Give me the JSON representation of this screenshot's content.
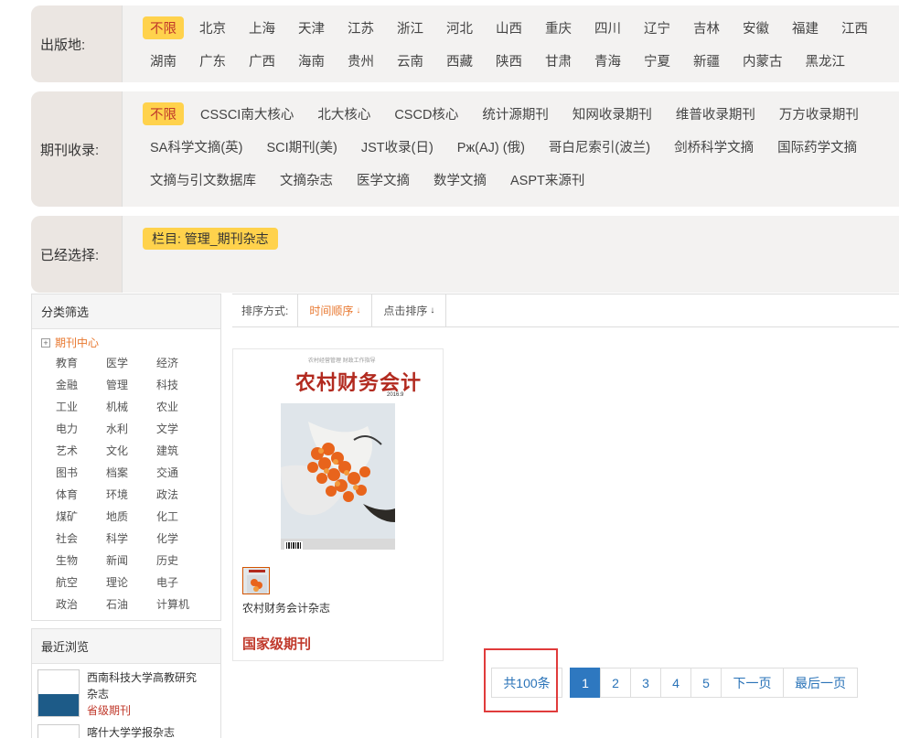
{
  "filters": {
    "place": {
      "label": "出版地:",
      "line1": [
        "不限",
        "北京",
        "上海",
        "天津",
        "江苏",
        "浙江",
        "河北",
        "山西",
        "重庆",
        "四川",
        "辽宁",
        "吉林",
        "安徽",
        "福建",
        "江西"
      ],
      "line2": [
        "湖南",
        "广东",
        "广西",
        "海南",
        "贵州",
        "云南",
        "西藏",
        "陕西",
        "甘肃",
        "青海",
        "宁夏",
        "新疆",
        "内蒙古",
        "黑龙江"
      ],
      "selected": "不限"
    },
    "index": {
      "label": "期刊收录:",
      "line1": [
        "不限",
        "CSSCI南大核心",
        "北大核心",
        "CSCD核心",
        "统计源期刊",
        "知网收录期刊",
        "维普收录期刊",
        "万方收录期刊"
      ],
      "line2": [
        "SA科学文摘(英)",
        "SCI期刊(美)",
        "JST收录(日)",
        "Рж(AJ) (俄)",
        "哥白尼索引(波兰)",
        "剑桥科学文摘",
        "国际药学文摘"
      ],
      "line3": [
        "文摘与引文数据库",
        "文摘杂志",
        "医学文摘",
        "数学文摘",
        "ASPT来源刊"
      ],
      "selected": "不限"
    },
    "chosen": {
      "label": "已经选择:",
      "tag": "栏目: 管理_期刊杂志"
    }
  },
  "sidebar": {
    "category_title": "分类筛选",
    "root": "期刊中心",
    "plus": "+",
    "categories": [
      "教育",
      "医学",
      "经济",
      "金融",
      "管理",
      "科技",
      "工业",
      "机械",
      "农业",
      "电力",
      "水利",
      "文学",
      "艺术",
      "文化",
      "建筑",
      "图书",
      "档案",
      "交通",
      "体育",
      "环境",
      "政法",
      "煤矿",
      "地质",
      "化工",
      "社会",
      "科学",
      "化学",
      "生物",
      "新闻",
      "历史",
      "航空",
      "理论",
      "电子",
      "政治",
      "石油",
      "计算机"
    ],
    "recent_title": "最近浏览",
    "recent": [
      {
        "name": "西南科技大学高教研究杂志",
        "level": "省级期刊"
      },
      {
        "name": "喀什大学学报杂志",
        "level": ""
      }
    ]
  },
  "sortbar": {
    "label": "排序方式:",
    "time": "时间顺序",
    "clicks": "点击排序",
    "arrow": "↓"
  },
  "journal": {
    "cover_title": "农村财务会计",
    "cover_top": "农村经营管理  财政工作指导",
    "cover_date": "2016.9",
    "name": "农村财务会计杂志",
    "level": "国家级期刊"
  },
  "pagination": {
    "total": "共100条",
    "pages": [
      "1",
      "2",
      "3",
      "4",
      "5"
    ],
    "current": "1",
    "next": "下一页",
    "last": "最后一页"
  },
  "colors": {
    "accent_yellow": "#ffd24c",
    "level_red": "#c0392b",
    "active_orange": "#e8772e",
    "page_blue": "#2e78c0",
    "highlight": "#e03b3b"
  }
}
